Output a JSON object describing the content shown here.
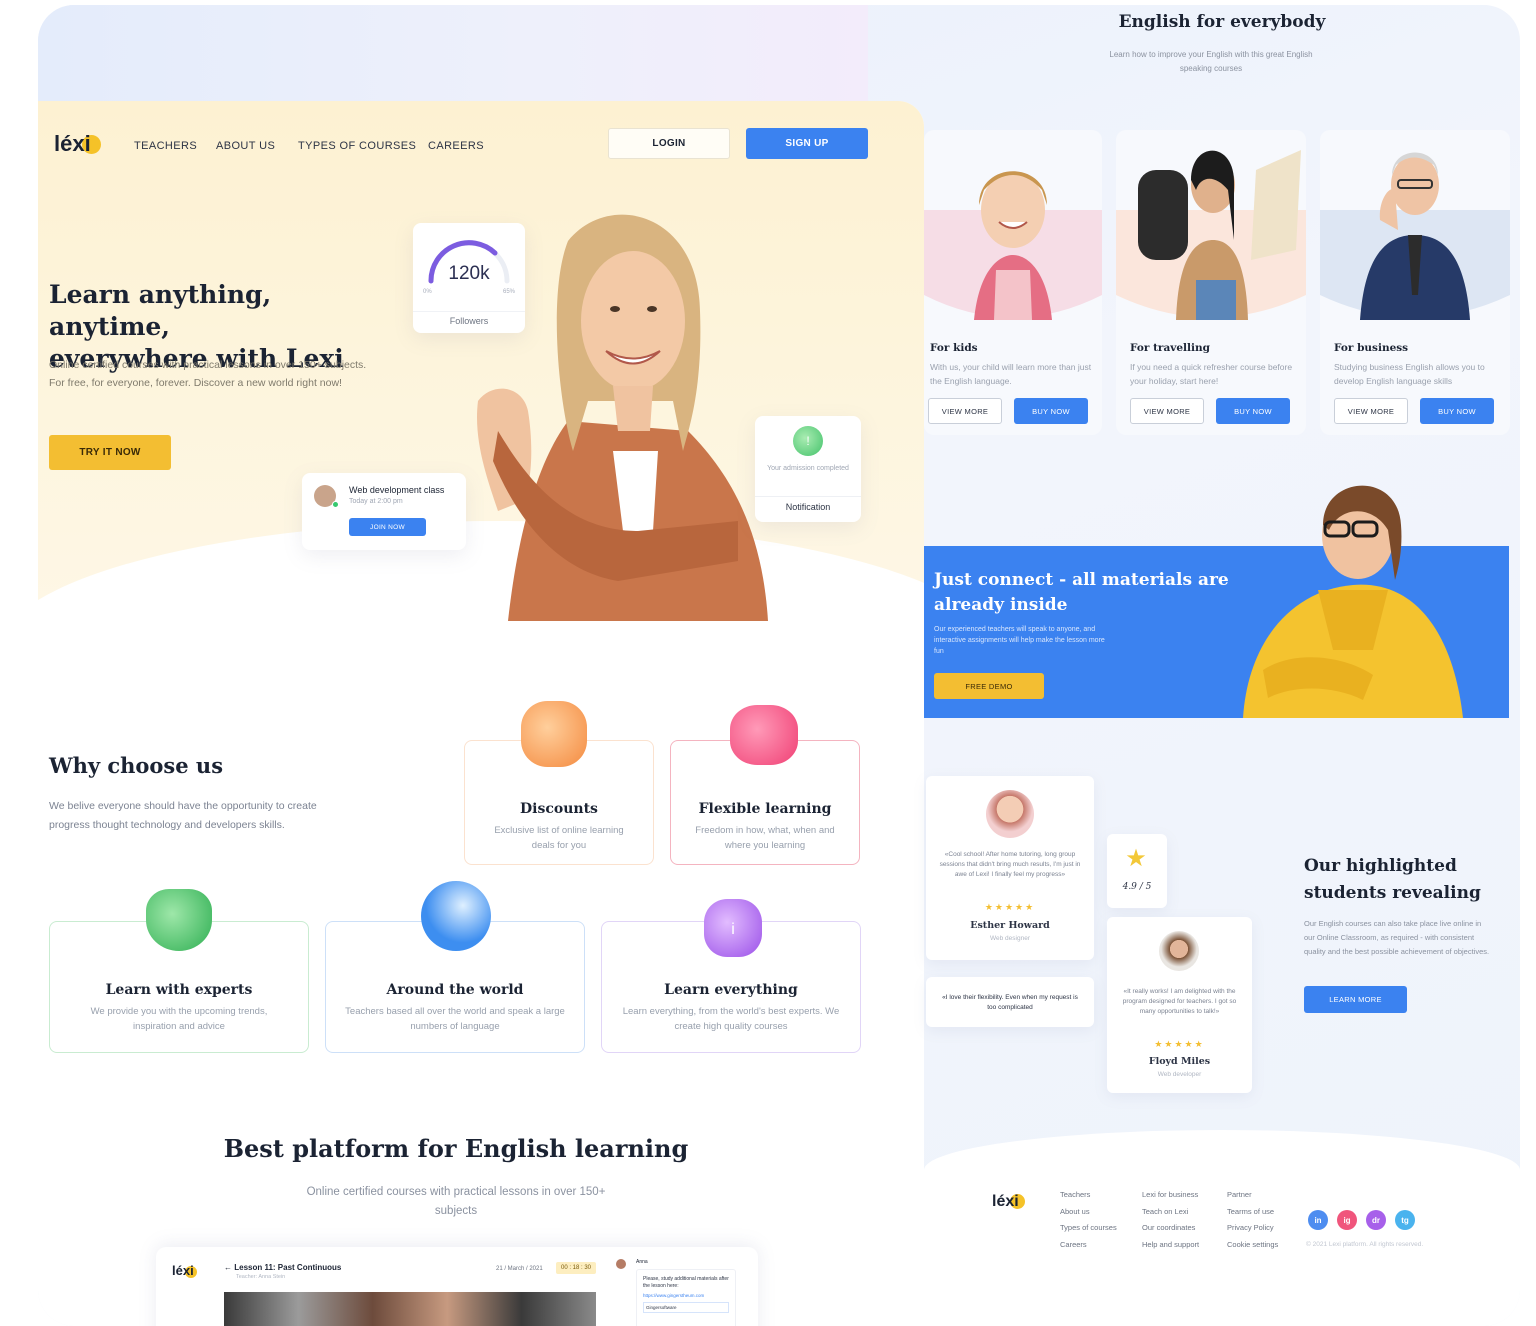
{
  "brand": {
    "name": "léxi"
  },
  "nav": {
    "links": [
      "TEACHERS",
      "ABOUT US",
      "TYPES OF COURSES",
      "CAREERS"
    ],
    "login": "LOGIN",
    "signup": "SIGN UP"
  },
  "hero": {
    "title_line1": "Learn anything, anytime,",
    "title_line2": "everywhere with Lexi",
    "subtitle": "Online certified courses with practical lessons in over 150+ subjects. For free, for everyone, forever. Discover a new world right now!",
    "cta": "TRY IT NOW",
    "followers": {
      "value": "120k",
      "min": "0%",
      "max": "65%",
      "label": "Followers"
    },
    "class_card": {
      "title": "Web development class",
      "time": "Today at 2:00 pm",
      "button": "JOIN NOW"
    },
    "notification": {
      "text": "Your admission completed",
      "label": "Notification"
    }
  },
  "why": {
    "title": "Why choose us",
    "text": "We belive everyone should have the opportunity to create progress thought technology and developers skills.",
    "cards": [
      {
        "title": "Discounts",
        "text": "Exclusive list of online learning deals for you"
      },
      {
        "title": "Flexible learning",
        "text": "Freedom in how, what, when and where you learning"
      },
      {
        "title": "Learn with experts",
        "text": "We provide you with the upcoming trends, inspiration and advice"
      },
      {
        "title": "Around the world",
        "text": "Teachers based all over the world and speak a large numbers of language"
      },
      {
        "title": "Learn everything",
        "text": "Learn everything, from the world's best experts. We create high quality courses"
      }
    ]
  },
  "platform": {
    "title": "Best platform for English learning",
    "text": "Online certified courses with practical lessons in over 150+ subjects",
    "lesson": {
      "title": "Lesson 11: Past Continuous",
      "teacher": "Teacher: Anna Stein",
      "date": "21 / March / 2021",
      "timer": "00 : 18 : 30",
      "chat_name": "Anna",
      "chat_msg": "Please, study additional materials after the lesson here:",
      "chat_link": "https://www.gingerstheum.com",
      "file": "Gingersoftware"
    }
  },
  "english": {
    "title": "English for everybody",
    "text": "Learn how to improve your English with this great English speaking courses",
    "courses": [
      {
        "title": "For kids",
        "text": "With us, your child will learn more than just the English language.",
        "view": "VIEW MORE",
        "buy": "BUY NOW"
      },
      {
        "title": "For travelling",
        "text": "If you need a quick refresher course before your holiday, start here!",
        "view": "VIEW MORE",
        "buy": "BUY NOW"
      },
      {
        "title": "For business",
        "text": "Studying business English allows you to develop English language skills",
        "view": "VIEW MORE",
        "buy": "BUY NOW"
      }
    ]
  },
  "banner": {
    "title_line1": "Just connect - all materials are",
    "title_line2": "already inside",
    "text": "Our experienced teachers will speak to anyone, and interactive assignments will help make the lesson more fun",
    "cta": "FREE DEMO"
  },
  "testimonials": {
    "title_line1": "Our highlighted",
    "title_line2": "students revealing",
    "text": "Our English courses can also take place live online in our Online Classroom, as required - with consistent quality and the best possible achievement of objectives.",
    "cta": "LEARN MORE",
    "rating": "4.9 / 5",
    "items": [
      {
        "quote": "«Cool school! After home tutoring, long group sessions that didn't bring much results, I'm just in awe of Lexi! I finally feel my progress»",
        "stars": "★★★★★",
        "name": "Esther Howard",
        "role": "Web designer"
      },
      {
        "quote": "«I love their flexibility. Even when my request is too complicated"
      },
      {
        "quote": "«It really works! I am delighted with the program designed for teachers. I got so many opportunities to talk!»",
        "stars": "★★★★★",
        "name": "Floyd Miles",
        "role": "Web developer"
      }
    ]
  },
  "footer": {
    "col1": [
      "Teachers",
      "About us",
      "Types of courses",
      "Careers"
    ],
    "col2": [
      "Lexi for business",
      "Teach on Lexi",
      "Our coordinates",
      "Help and support"
    ],
    "col3": [
      "Partner",
      "Tearms of use",
      "Privacy Policy",
      "Cookie settings"
    ],
    "social": [
      "in",
      "ig",
      "dr",
      "tg"
    ],
    "copyright": "© 2021 Lexi platform. All rights reserved."
  },
  "colors": {
    "accent": "#3b82f0",
    "yellow": "#f3be32"
  }
}
